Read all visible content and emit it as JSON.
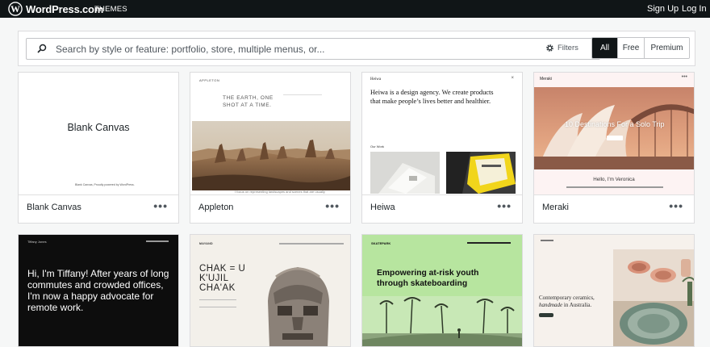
{
  "masterbar": {
    "brand": "WordPress.com",
    "section": "THEMES",
    "signup": "Sign Up",
    "login": "Log In"
  },
  "search": {
    "placeholder": "Search by style or feature: portfolio, store, multiple menus, or...",
    "filters_label": "Filters",
    "tabs": [
      "All",
      "Free",
      "Premium"
    ],
    "active_tab": "All"
  },
  "themes": [
    {
      "name": "Blank Canvas",
      "preview": {
        "title": "Blank Canvas",
        "footer": "Blank Canvas, Proudly powered by WordPress."
      }
    },
    {
      "name": "Appleton",
      "preview": {
        "nav": "APPLETON",
        "headline": "THE EARTH, ONE SHOT AT A TIME.",
        "caption": "I focus on representing landscapes and scenes that are usually"
      }
    },
    {
      "name": "Heiwa",
      "preview": {
        "nav": "Heiwa",
        "headline": "Heiwa is a design agency. We create products that make people’s lives better and healthier.",
        "section": "Our Work"
      }
    },
    {
      "name": "Meraki",
      "preview": {
        "nav": "Meraki",
        "headline": "10 Destinations For a Solo Trip",
        "hello": "Hello, I'm Veronica"
      }
    },
    {
      "name": "",
      "preview": {
        "nav": "Tiffany Jones",
        "headline": "Hi, I'm Tiffany! After years of long commutes and crowded offices, I'm now a happy advocate for remote work."
      }
    },
    {
      "name": "",
      "preview": {
        "nav": "MAYAND",
        "headline": "CHAK = U K'UJIL CHA'AK"
      }
    },
    {
      "name": "",
      "preview": {
        "nav": "SKATEPARK",
        "headline": "Empowering at-risk youth through skateboarding"
      }
    },
    {
      "name": "",
      "preview": {
        "headline_plain": "Contemporary ceramics, ",
        "headline_italic": "handmade",
        "headline_end": " in Australia."
      }
    }
  ],
  "colors": {
    "masterbar": "#101517",
    "accent_green": "#b7e59f",
    "meraki_sky": "#d98f6e"
  }
}
